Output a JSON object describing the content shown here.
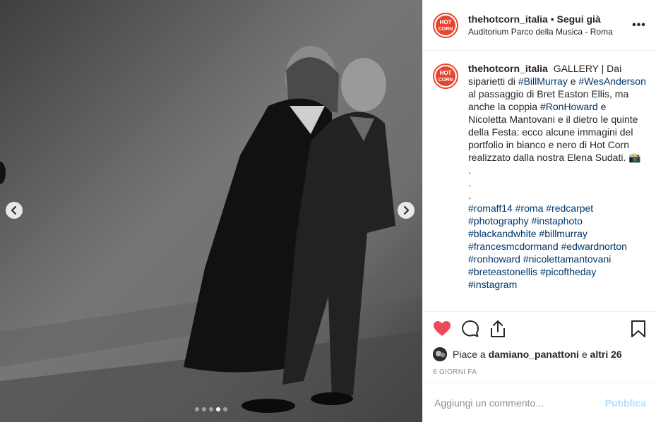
{
  "post": {
    "username": "thehotcorn_italia",
    "bullet": "•",
    "follow_state": "Segui già",
    "location": "Auditorium Parco della Musica - Roma",
    "more_label": "•••",
    "avatar_text": "HOT CORN"
  },
  "caption": {
    "username": "thehotcorn_italia",
    "text_1": "GALLERY | Dai siparietti di",
    "tag_billmurray": "#BillMurray",
    "text_2": "e",
    "tag_wesanderson": "#WesAnderson",
    "text_3": "al passaggio di Bret Easton Ellis, ma anche la coppia",
    "tag_ronhoward": "#RonHoward",
    "text_4": "e Nicoletta Mantovani e il dietro le quinte della Festa: ecco alcune immagini del portfolio in bianco e nero di Hot Corn realizzato dalla nostra Elena Sudati. 📸",
    "dot_1": ".",
    "dot_2": ".",
    "dot_3": ".",
    "hashtags": [
      "#romaff14",
      "#roma",
      "#redcarpet",
      "#photography",
      "#instaphoto",
      "#blackandwhite",
      "#billmurray",
      "#francesmcdormand",
      "#edwardnorton",
      "#ronhoward",
      "#nicolettamantovani",
      "#breteastonellis",
      "#picoftheday",
      "#instagram"
    ]
  },
  "likes": {
    "prefix": "Piace a",
    "user": "damiano_panattoni",
    "joiner": "e",
    "others": "altri 26"
  },
  "timestamp": "6 GIORNI FA",
  "comment": {
    "placeholder": "Aggiungi un commento...",
    "post_label": "Pubblica"
  },
  "carousel": {
    "count": 5,
    "active_index": 3
  },
  "colors": {
    "like_red": "#ed4956",
    "link_blue": "#003569",
    "brand_red": "#e8452f",
    "post_disabled": "#b2dffc"
  },
  "icons": [
    "chevron-left-icon",
    "chevron-right-icon",
    "heart-icon",
    "comment-icon",
    "share-icon",
    "bookmark-icon",
    "more-icon"
  ]
}
